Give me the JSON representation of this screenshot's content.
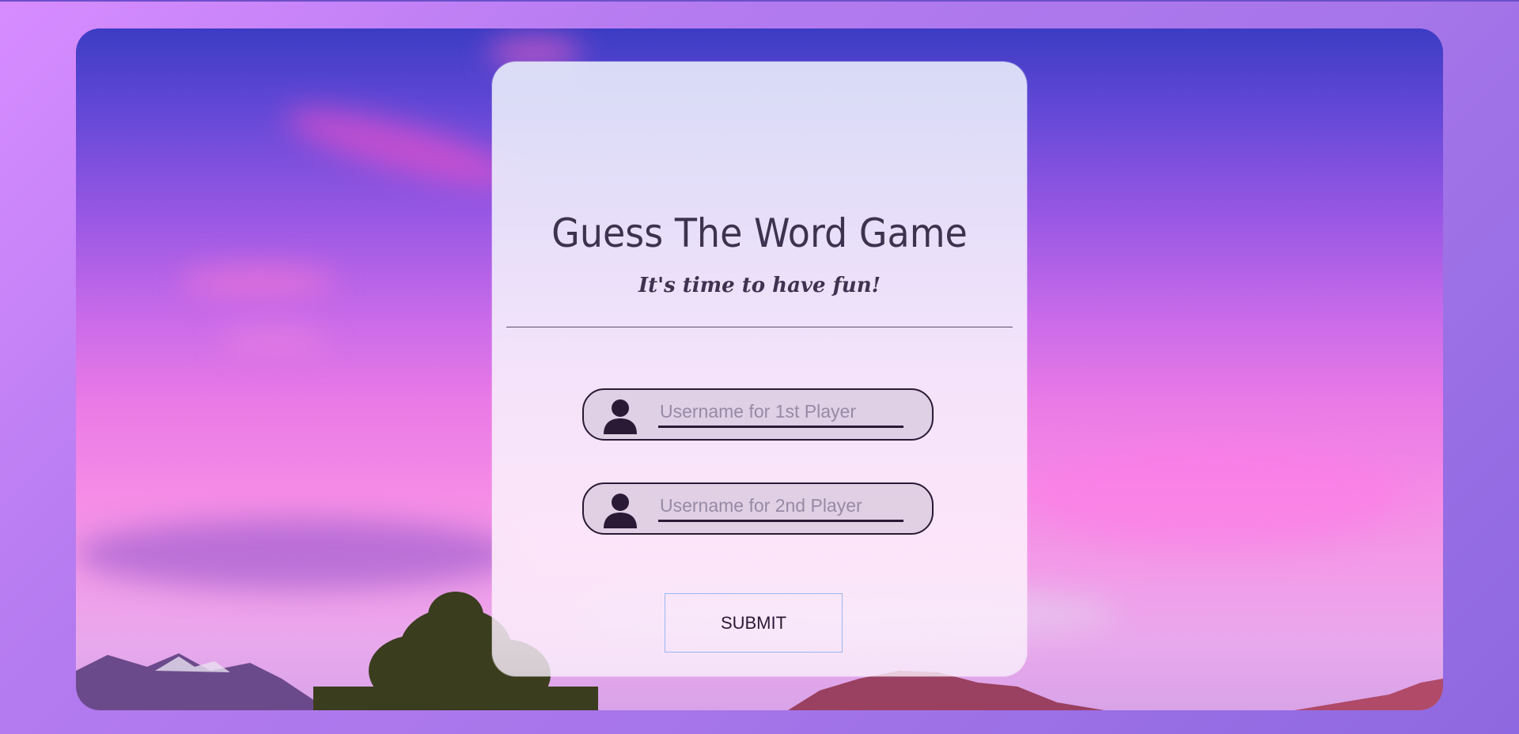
{
  "game": {
    "title": "Guess The Word Game",
    "subtitle": "It's time to have fun!"
  },
  "form": {
    "player1": {
      "placeholder": "Username for 1st Player",
      "value": "",
      "icon": "user-icon"
    },
    "player2": {
      "placeholder": "Username for 2nd Player",
      "value": "",
      "icon": "user-icon"
    },
    "submit_label": "SUBMIT"
  },
  "colors": {
    "text_dark": "#3d3350",
    "field_border": "#2a1a35",
    "button_border": "#9ab7f0"
  }
}
